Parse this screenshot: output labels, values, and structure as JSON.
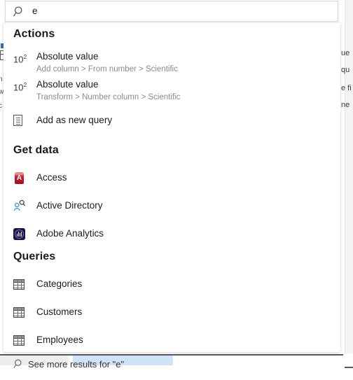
{
  "search": {
    "icon": "search-icon",
    "value": "e",
    "placeholder": "Search"
  },
  "background": {
    "right_fragments": [
      "ue",
      "qu",
      "e fi",
      "ne"
    ],
    "left_fragments": [
      "n",
      "w",
      "c"
    ]
  },
  "panel": {
    "sections": [
      {
        "id": "actions",
        "header": "Actions",
        "items": [
          {
            "icon": "scientific-notation-icon",
            "icon_text": "10",
            "icon_sup": "2",
            "title": "Absolute value",
            "subtitle": "Add column > From number > Scientific"
          },
          {
            "icon": "scientific-notation-icon",
            "icon_text": "10",
            "icon_sup": "2",
            "title": "Absolute value",
            "subtitle": "Transform > Number column > Scientific"
          },
          {
            "icon": "document-icon",
            "title": "Add as new query",
            "subtitle": ""
          }
        ]
      },
      {
        "id": "get-data",
        "header": "Get data",
        "items": [
          {
            "icon": "access-icon",
            "title": "Access",
            "subtitle": ""
          },
          {
            "icon": "active-directory-icon",
            "title": "Active Directory",
            "subtitle": ""
          },
          {
            "icon": "adobe-analytics-icon",
            "title": "Adobe Analytics",
            "subtitle": ""
          }
        ]
      },
      {
        "id": "queries",
        "header": "Queries",
        "items": [
          {
            "icon": "table-icon",
            "title": "Categories",
            "subtitle": ""
          },
          {
            "icon": "table-icon",
            "title": "Customers",
            "subtitle": ""
          },
          {
            "icon": "table-icon",
            "title": "Employees",
            "subtitle": ""
          }
        ]
      }
    ],
    "footer": {
      "icon": "search-icon",
      "label": "See more results for \"e\""
    }
  },
  "colors": {
    "panel_background": "#ffffff",
    "header_text": "#1b1b1b",
    "subtitle_text": "#8a8a8a",
    "access_red": "#c0202b",
    "active_directory_blue": "#2b8fd6",
    "adobe_navy": "#1d1145",
    "selection_blue": "#cfe2f6"
  }
}
